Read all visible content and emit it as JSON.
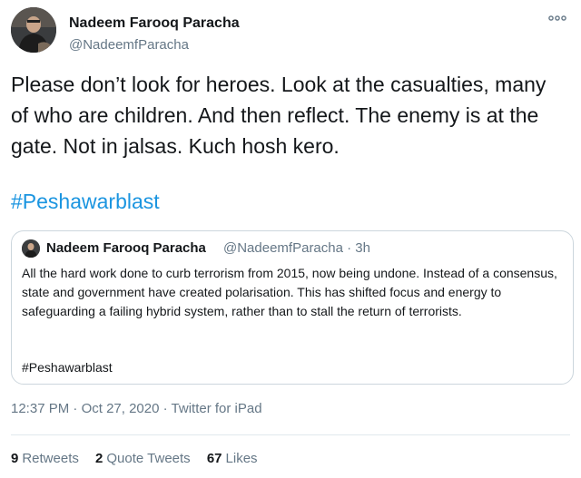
{
  "author": {
    "name": "Nadeem Farooq Paracha",
    "handle": "@NadeemfParacha"
  },
  "tweet": {
    "text": "Please don’t look for heroes. Look at the casualties, many of who are children. And then reflect. The enemy is at the gate. Not in jalsas. Kuch hosh kero.",
    "hashtag": "#Peshawarblast"
  },
  "quoted_tweet": {
    "name": "Nadeem Farooq Paracha",
    "handle_time": "@NadeemfParacha · 3h",
    "text": "All the hard work done to curb terrorism from 2015, now being undone. Instead of a consensus, state and government have created polarisation. This has shifted focus and energy to safeguarding a failing hybrid system, rather than to stall the return of terrorists.",
    "hashtag": "#Peshawarblast"
  },
  "meta": {
    "time": "12:37 PM",
    "separator1": " · ",
    "date": "Oct 27, 2020",
    "separator2": " · ",
    "source": "Twitter for iPad"
  },
  "stats": {
    "retweets_count": "9",
    "retweets_label": "Retweets",
    "quotes_count": "2",
    "quotes_label": "Quote Tweets",
    "likes_count": "67",
    "likes_label": "Likes"
  },
  "icons": {
    "more": "more-horizontal-icon",
    "avatar": "avatar"
  },
  "colors": {
    "link": "#1b95e0",
    "secondary_text": "#657786",
    "border": "#ccd6dd"
  }
}
